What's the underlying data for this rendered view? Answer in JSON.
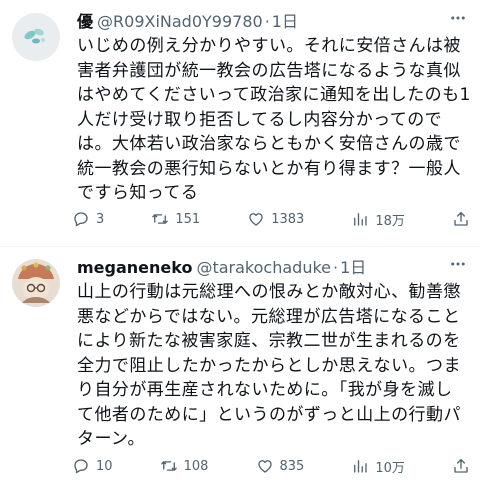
{
  "tweets": [
    {
      "name": "優",
      "handle": "@R09XiNad0Y99780",
      "dot": "·",
      "time": "1日",
      "lines": [
        "いじめの例え分かりやすい。それに安倍さんは被",
        "害者弁護団が統一教会の広告塔になるような真似",
        "はやめてくださいって政治家に通知を出したのも1",
        "人だけ受け取り拒否してるし内容分かってので",
        "は。大体若い政治家ならともかく安倍さんの歳で",
        "統一教会の悪行知らないとか有り得ます？一般人",
        "ですら知ってる"
      ],
      "replies": "3",
      "retweets": "151",
      "likes": "1383",
      "views": "18万"
    },
    {
      "name": "meganeneko",
      "handle": "@tarakochaduke",
      "dot": "·",
      "time": "1日",
      "lines": [
        "山上の行動は元総理への恨みとか敵対心、勧善懲",
        "悪などからではない。元総理が広告塔になること",
        "により新たな被害家庭、宗教二世が生まれるのを",
        "全力で阻止したかったからとしか思えない。つま",
        "り自分が再生産されないために。「我が身を滅し",
        "て他者のために」というのがずっと山上の行動パ",
        "ターン。"
      ],
      "replies": "10",
      "retweets": "108",
      "likes": "835",
      "views": "10万"
    }
  ],
  "icons": {
    "reply": "reply-icon",
    "retweet": "retweet-icon",
    "like": "heart-icon",
    "views": "views-icon",
    "share": "share-icon",
    "more": "more-icon"
  },
  "colors": {
    "text": "#0f1419",
    "secondary": "#536471",
    "divider": "#eff3f4"
  }
}
